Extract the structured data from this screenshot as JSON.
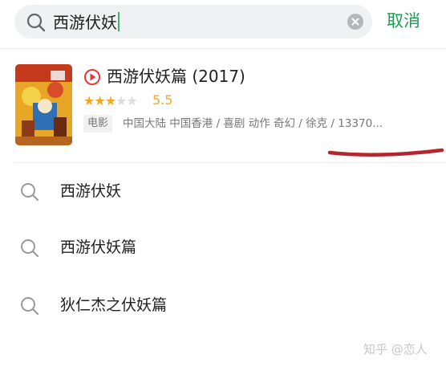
{
  "search": {
    "query": "西游伏妖",
    "cancel_label": "取消"
  },
  "result": {
    "title": "西游伏妖篇",
    "year": "(2017)",
    "rating_value": "5.5",
    "rating_fraction": 0.55,
    "stars_filled": 3,
    "stars_total": 5,
    "type_label": "电影",
    "meta": "中国大陆 中国香港 / 喜剧 动作 奇幻 / 徐克 / 13370..."
  },
  "suggestions": [
    {
      "label": "西游伏妖"
    },
    {
      "label": "西游伏妖篇"
    },
    {
      "label": "狄仁杰之伏妖篇"
    }
  ],
  "watermark": "知乎 @恋人",
  "colors": {
    "accent": "#1e9e55",
    "star": "#f6a623",
    "play": "#e53935",
    "annotation": "#b3262d"
  }
}
